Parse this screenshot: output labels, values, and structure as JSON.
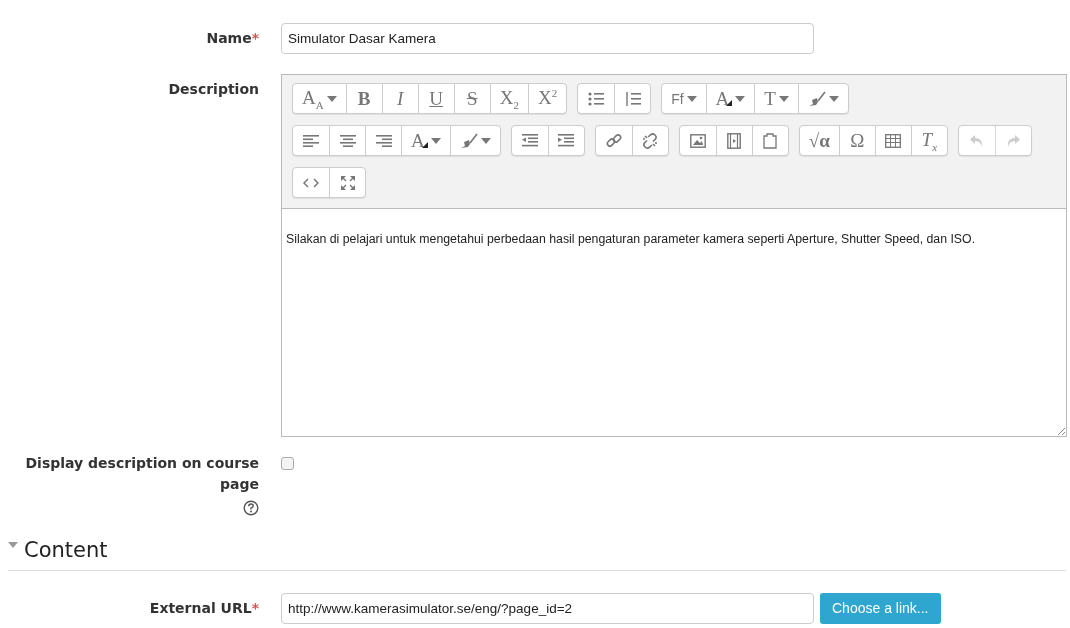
{
  "fields": [
    {
      "label": "Name",
      "required_mark": "*",
      "value": "Simulator Dasar Kamera"
    }
  ],
  "description": {
    "label": "Description",
    "toolbar": [
      [
        [
          {
            "kind": "text",
            "label": "A$_{A}$",
            "dropdown": true
          },
          {
            "kind": "bold",
            "label": "B"
          },
          {
            "kind": "italic",
            "label": "I"
          },
          {
            "kind": "underline",
            "label": "U"
          },
          {
            "kind": "strike",
            "label": "S"
          },
          {
            "kind": "text",
            "label": "X$_{2}$"
          },
          {
            "kind": "text",
            "label": "X$^{2}$"
          }
        ],
        [
          {
            "kind": "bullets"
          },
          {
            "kind": "numbers"
          }
        ],
        [
          {
            "kind": "text",
            "label": "Ff",
            "dropdown": true
          },
          {
            "kind": "color",
            "label": "A",
            "dropdown": true
          },
          {
            "kind": "text",
            "label": "T",
            "dropdown": true
          },
          {
            "kind": "highlight",
            "dropdown": true
          }
        ]
      ],
      [
        [
          {
            "kind": "alignleft"
          },
          {
            "kind": "aligncenter"
          },
          {
            "kind": "alignright"
          },
          {
            "kind": "color",
            "label": "A",
            "dropdown": true
          },
          {
            "kind": "highlight",
            "dropdown": true
          }
        ],
        [
          {
            "kind": "outdent"
          },
          {
            "kind": "indent"
          }
        ],
        [
          {
            "kind": "link"
          },
          {
            "kind": "unlink"
          }
        ],
        [
          {
            "kind": "image"
          },
          {
            "kind": "media"
          },
          {
            "kind": "paste"
          }
        ],
        [
          {
            "kind": "bold",
            "label": "√α"
          },
          {
            "kind": "text",
            "label": "Ω"
          },
          {
            "kind": "table"
          },
          {
            "kind": "italic",
            "label": "T$_{x}$"
          }
        ],
        [
          {
            "kind": "undo",
            "disabled": true
          },
          {
            "kind": "redo",
            "disabled": true
          }
        ]
      ],
      [
        [
          {
            "kind": "html"
          },
          {
            "kind": "fullscreen"
          }
        ]
      ]
    ],
    "text": "Silakan di pelajari untuk mengetahui perbedaan hasil pengaturan parameter kamera seperti Aperture, Shutter Speed, dan ISO."
  },
  "display_option": {
    "label": "Display description on course page",
    "checked": false
  },
  "section": {
    "title": "Content",
    "expanded": true
  },
  "url_field": {
    "label": "External URL",
    "required_mark": "*",
    "value": "http://www.kamerasimulator.se/eng/?page_id=2",
    "button": "Choose a link..."
  }
}
